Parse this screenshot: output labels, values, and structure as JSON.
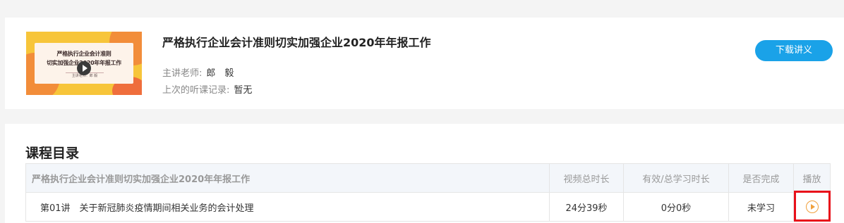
{
  "course": {
    "title": "严格执行企业会计准则切实加强企业2020年年报工作",
    "thumbnail": {
      "line1": "严格执行企业会计准则",
      "line2": "切实加强企业2020年年报工作",
      "teacher_label": "主讲老师：郎 毅"
    },
    "teacher_label": "主讲老师:",
    "teacher_name": "郎　毅",
    "record_label": "上次的听课记录:",
    "record_value": "暂无",
    "download_label": "下载讲义"
  },
  "catalog": {
    "title": "课程目录",
    "headers": [
      "严格执行企业会计准则切实加强企业2020年年报工作",
      "视频总时长",
      "有效/总学习时长",
      "是否完成",
      "播放"
    ],
    "rows": [
      {
        "lesson": "第01讲　关于新冠肺炎疫情期间相关业务的会计处理",
        "duration": "24分39秒",
        "study_time": "0分0秒",
        "status": "未学习",
        "play_icon": "play-circle-icon"
      }
    ]
  },
  "colors": {
    "accent_blue": "#1aa2e8",
    "status_green": "#2db34a",
    "play_orange": "#f0a03c",
    "highlight_red": "#e8101a"
  }
}
